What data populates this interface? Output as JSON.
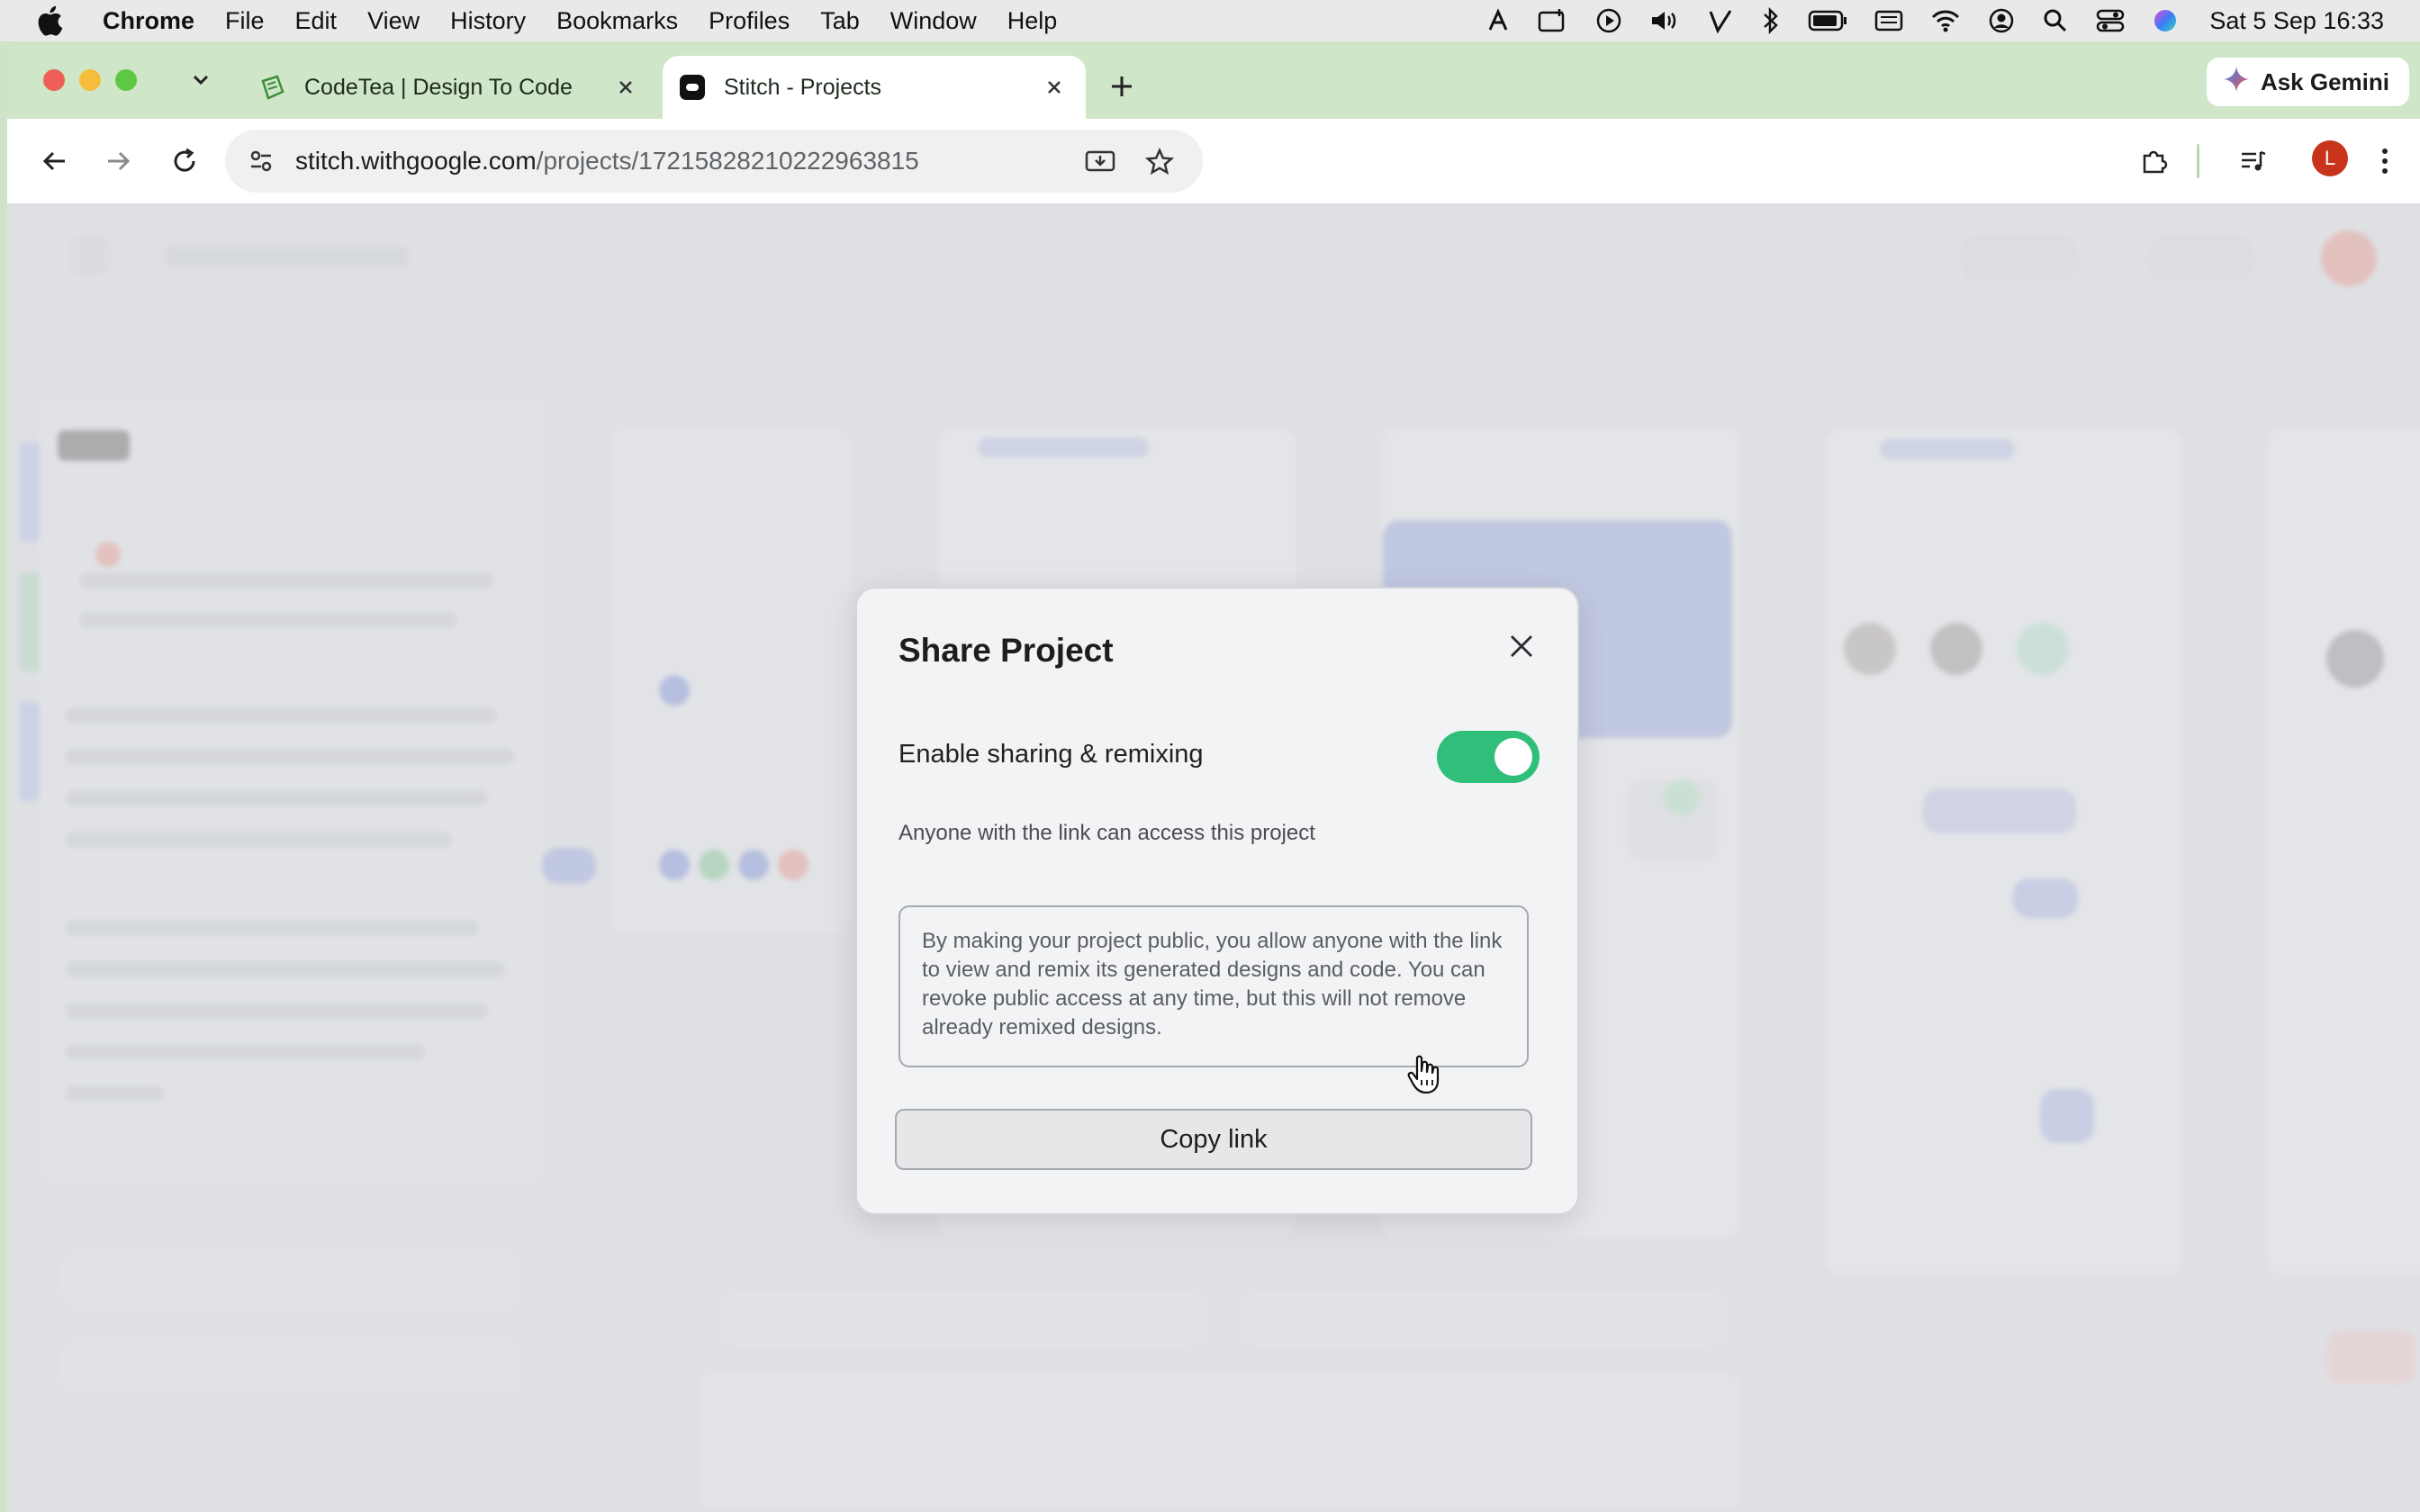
{
  "menubar": {
    "app_name": "Chrome",
    "items": [
      "File",
      "Edit",
      "View",
      "History",
      "Bookmarks",
      "Profiles",
      "Tab",
      "Window",
      "Help"
    ],
    "clock": "Sat 5 Sep  16:33"
  },
  "browser": {
    "tabs": [
      {
        "title": "CodeTea | Design To Code",
        "active": false
      },
      {
        "title": "Stitch - Projects",
        "active": true
      }
    ],
    "gemini_label": "Ask Gemini",
    "url_host": "stitch.withgoogle.com",
    "url_path": "/projects/17215828210222963815",
    "profile_initial": "L",
    "colors": {
      "tabstrip": "#cfe6c8",
      "profile": "#c7341b"
    }
  },
  "modal": {
    "title": "Share Project",
    "toggle_label": "Enable sharing & remixing",
    "toggle_on": true,
    "toggle_description": "Anyone with the link can access this project",
    "notice": "By making your project public, you allow anyone with the link to view and remix its generated designs and code. You can revoke public access at any time, but this will not remove already remixed designs.",
    "copy_button": "Copy link",
    "colors": {
      "toggle": "#2fbf7a"
    }
  }
}
